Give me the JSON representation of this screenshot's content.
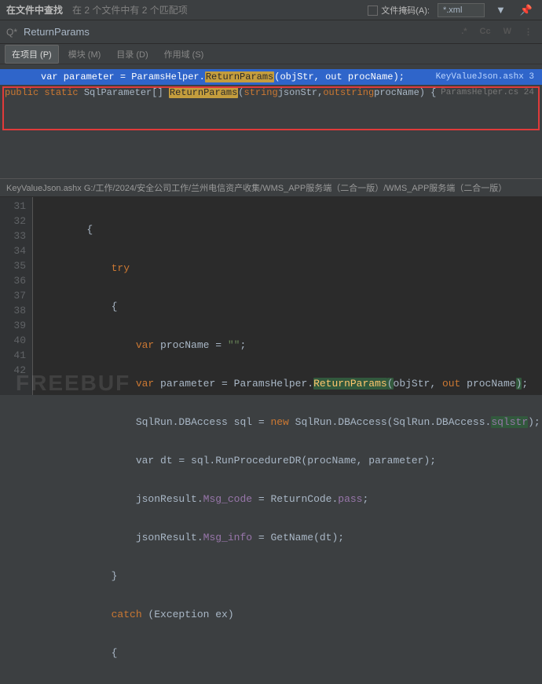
{
  "topbar": {
    "title": "在文件中查找",
    "matches": "在 2 个文件中有 2 个匹配项",
    "mask_label": "文件掩码(A):",
    "mask_value": "*.xml"
  },
  "search": {
    "icon_label": "Q*",
    "query": "ReturnParams",
    "toggles": {
      "star": ".*",
      "cc": "Cc",
      "w": "W"
    }
  },
  "scopes": {
    "project": "在项目 (P)",
    "module": "模块 (M)",
    "directory": "目录 (D)",
    "scope": "作用域 (S)"
  },
  "results": [
    {
      "prefix": "var parameter = ParamsHelper.",
      "match": "ReturnParams",
      "suffix": "(objStr, out procName);",
      "file": "KeyValueJson.ashx 3",
      "selected": true
    },
    {
      "tokens": {
        "public": "public",
        "static": "static",
        "type": "SqlParameter[]",
        "match": "ReturnParams",
        "open": "(",
        "p1type": "string",
        "p1name": " jsonStr,",
        "out": "out ",
        "p2type": "string",
        "p2name": " procName) {"
      },
      "file": "ParamsHelper.cs 24"
    }
  ],
  "breadcrumb": "KeyValueJson.ashx  G:/工作/2024/安全公司工作/兰州电信资产收集/WMS_APP服务端（二合一版）/WMS_APP服务端（二合一版）",
  "lines": [
    "31",
    "32",
    "33",
    "34",
    "35",
    "36",
    "37",
    "38",
    "39",
    "40",
    "41",
    "42"
  ],
  "code": {
    "l31": "        {",
    "l32": "            try",
    "l33": "            {",
    "l34_a": "                var",
    "l34_b": " procName = ",
    "l34_c": "\"\"",
    "l34_d": ";",
    "l35_a": "                var",
    "l35_b": " parameter = ParamsHelper.",
    "l35_m": "ReturnParams",
    "l35_c": "(",
    "l35_d": "objStr, ",
    "l35_e": "out",
    "l35_f": " procName",
    "l35_g": ")",
    "l35_h": ";",
    "l36_a": "                SqlRun.DBAccess sql = ",
    "l36_b": "new",
    "l36_c": " SqlRun.DBAccess(SqlRun.DBAccess.",
    "l36_d": "sqlstr",
    "l36_e": ");",
    "l37": "                var dt = sql.RunProcedureDR(procName, parameter);",
    "l38_a": "                jsonResult.",
    "l38_b": "Msg_code",
    "l38_c": " = ReturnCode.",
    "l38_d": "pass",
    "l38_e": ";",
    "l39_a": "                jsonResult.",
    "l39_b": "Msg_info",
    "l39_c": " = GetName(dt);",
    "l40": "            }",
    "l41_a": "            catch",
    "l41_b": " (Exception ex)",
    "l42": "            {"
  },
  "watermark": "FREEBUF"
}
